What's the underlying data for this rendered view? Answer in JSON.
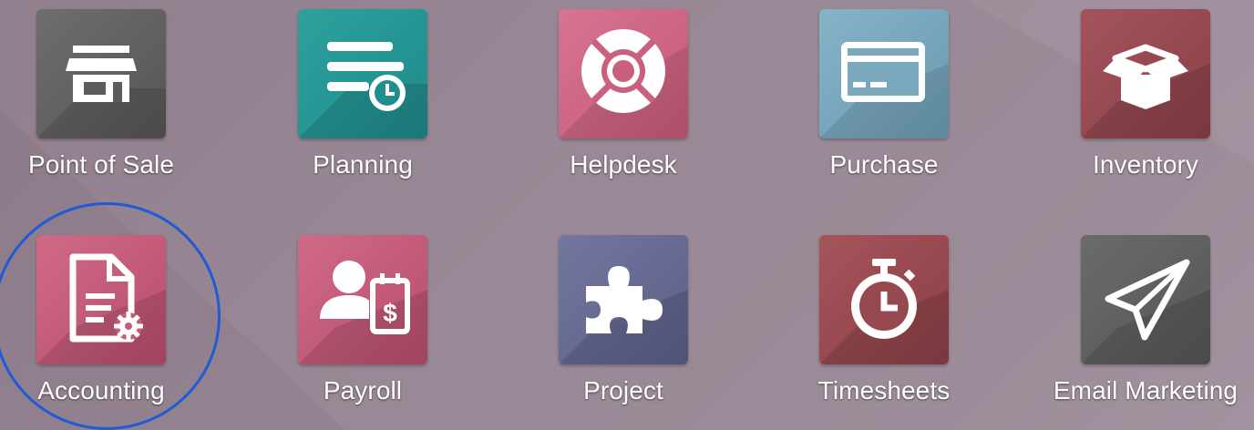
{
  "apps": [
    {
      "id": "point-of-sale",
      "label": "Point of Sale",
      "icon": "store-icon",
      "color": "#5a5a5a",
      "color_light": "#727272"
    },
    {
      "id": "planning",
      "label": "Planning",
      "icon": "planning-clock-icon",
      "color": "#1d8a8a",
      "color_light": "#2ea19d"
    },
    {
      "id": "helpdesk",
      "label": "Helpdesk",
      "icon": "lifebuoy-icon",
      "color": "#c45876",
      "color_light": "#d67590"
    },
    {
      "id": "purchase",
      "label": "Purchase",
      "icon": "credit-card-icon",
      "color": "#6a99b0",
      "color_light": "#86b3c8"
    },
    {
      "id": "inventory",
      "label": "Inventory",
      "icon": "box-icon",
      "color": "#8a3f47",
      "color_light": "#a4535b"
    },
    {
      "id": "accounting",
      "label": "Accounting",
      "icon": "document-gear-icon",
      "color": "#b84e6c",
      "color_light": "#cf6a85"
    },
    {
      "id": "payroll",
      "label": "Payroll",
      "icon": "person-payslip-icon",
      "color": "#b84e6c",
      "color_light": "#cf6a85"
    },
    {
      "id": "project",
      "label": "Project",
      "icon": "puzzle-icon",
      "color": "#5b5e86",
      "color_light": "#73779e"
    },
    {
      "id": "timesheets",
      "label": "Timesheets",
      "icon": "stopwatch-icon",
      "color": "#8c3f46",
      "color_light": "#a5545a"
    },
    {
      "id": "email-marketing",
      "label": "Email Marketing",
      "icon": "paper-plane-icon",
      "color": "#555555",
      "color_light": "#6b6b6b"
    }
  ],
  "highlight": {
    "target": "accounting",
    "color": "#1f5bd6"
  }
}
